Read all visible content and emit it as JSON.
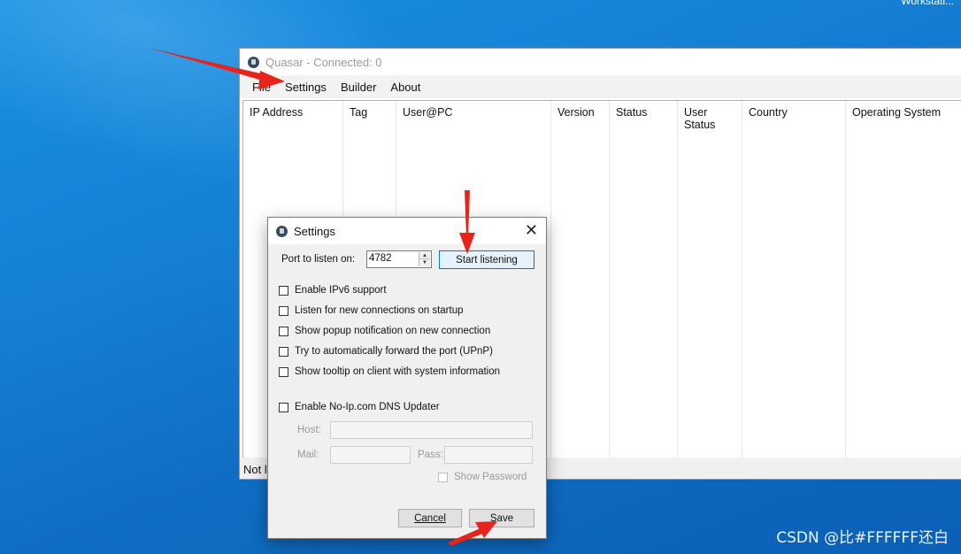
{
  "desktop": {
    "corner_text": "Workstati...",
    "watermark": "CSDN @比#FFFFFF还白"
  },
  "main_window": {
    "title": "Quasar - Connected: 0",
    "menu": [
      "File",
      "Settings",
      "Builder",
      "About"
    ],
    "columns": [
      "IP Address",
      "Tag",
      "User@PC",
      "Version",
      "Status",
      "User Status",
      "Country",
      "Operating System"
    ],
    "status_text": "Not l"
  },
  "settings_dialog": {
    "title": "Settings",
    "port_label": "Port to listen on:",
    "port_value": "4782",
    "start_button": "Start listening",
    "options": [
      {
        "label": "Enable IPv6 support",
        "checked": false
      },
      {
        "label": "Listen for new connections on startup",
        "checked": false
      },
      {
        "label": "Show popup notification on new connection",
        "checked": false
      },
      {
        "label": "Try to automatically forward the port (UPnP)",
        "checked": false
      },
      {
        "label": "Show tooltip on client with system information",
        "checked": false
      }
    ],
    "noip": {
      "label": "Enable No-Ip.com DNS Updater",
      "checked": false
    },
    "host_label": "Host:",
    "mail_label": "Mail:",
    "pass_label": "Pass:",
    "show_password": "Show Password",
    "cancel_button": "Cancel",
    "save_button": "Save"
  },
  "colors": {
    "arrow": "#e8231b",
    "desktop": "#1580d4",
    "focus": "#0078d7"
  }
}
